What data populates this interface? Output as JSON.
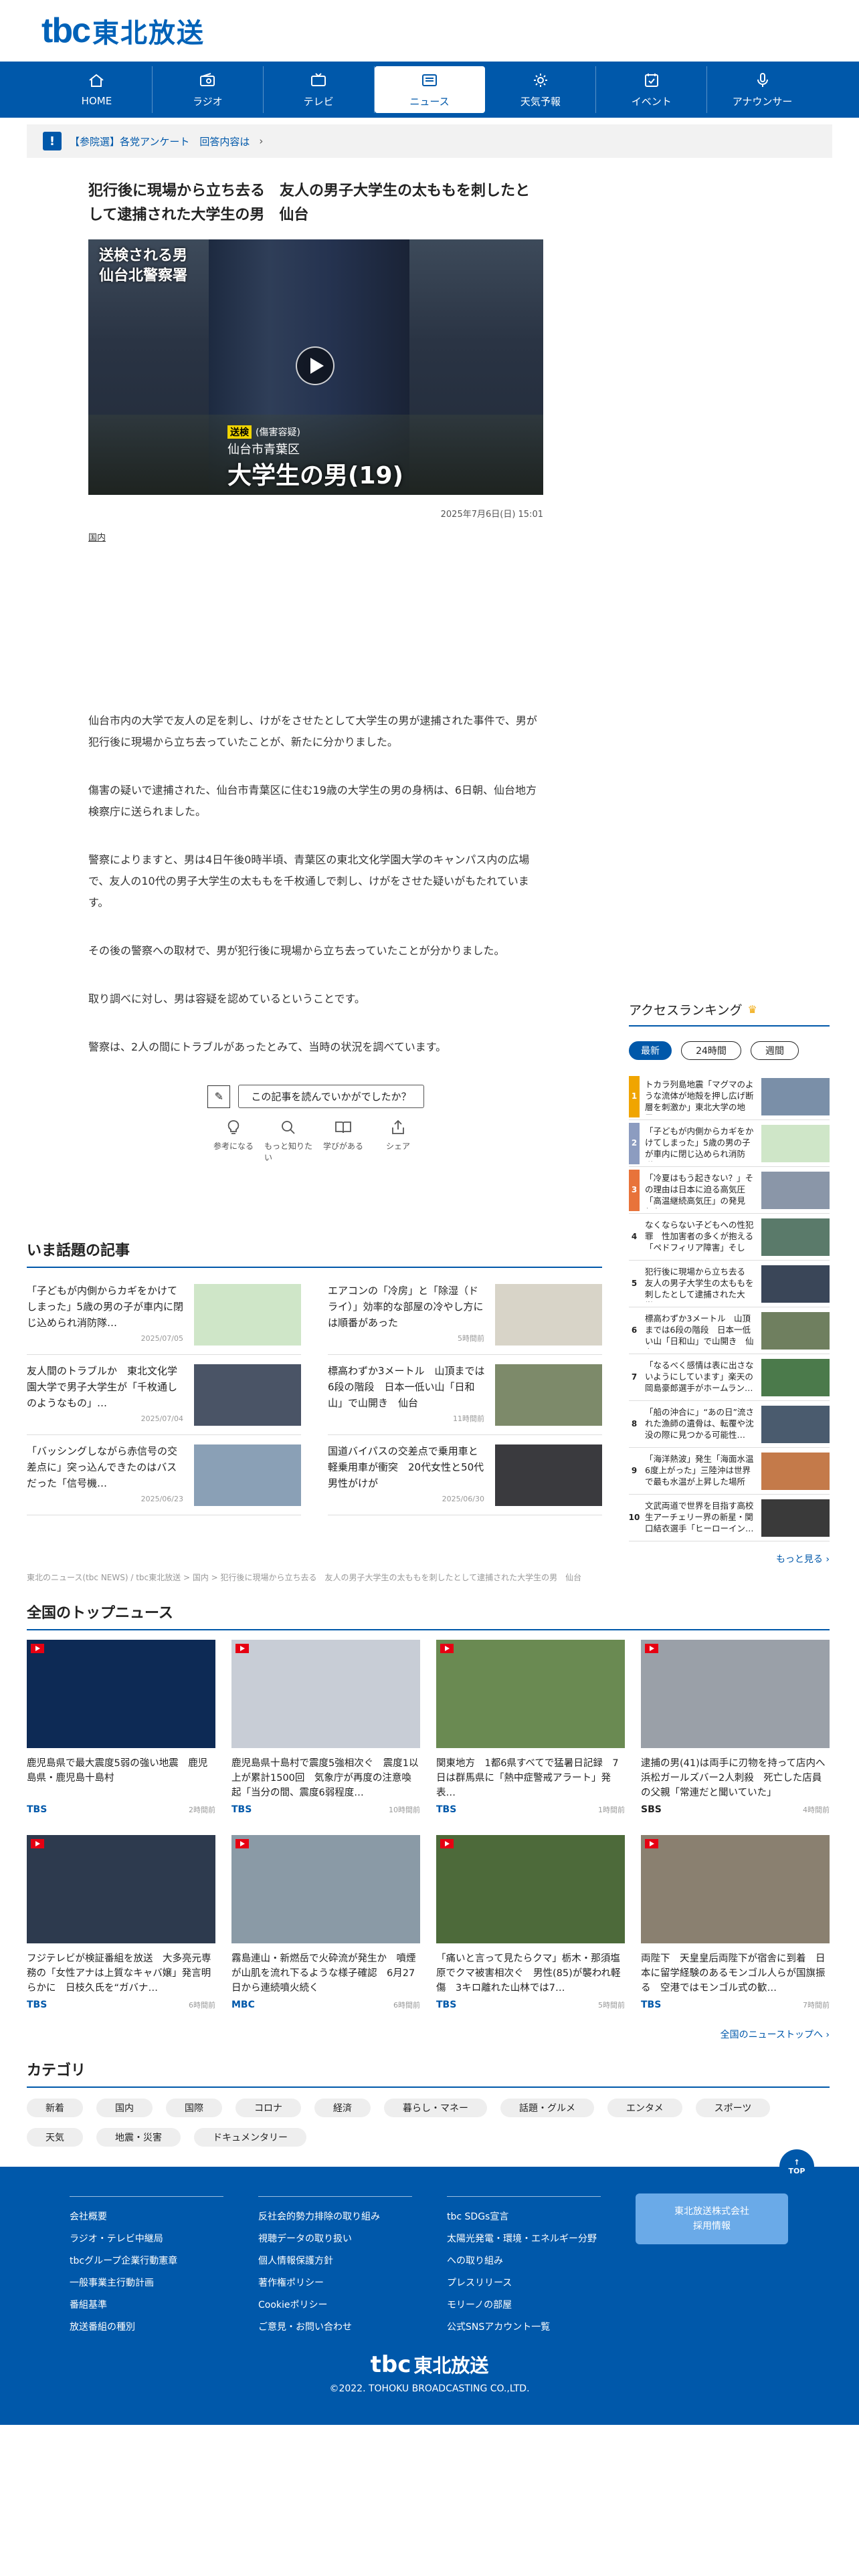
{
  "brand": {
    "mark": "tbc",
    "name": "東北放送",
    "color": "#0058aa"
  },
  "nav": [
    {
      "label": "HOME",
      "icon": "home-icon"
    },
    {
      "label": "ラジオ",
      "icon": "radio-icon"
    },
    {
      "label": "テレビ",
      "icon": "tv-icon"
    },
    {
      "label": "ニュース",
      "icon": "news-icon",
      "active": true
    },
    {
      "label": "天気予報",
      "icon": "weather-icon"
    },
    {
      "label": "イベント",
      "icon": "event-icon"
    },
    {
      "label": "アナウンサー",
      "icon": "mic-icon"
    }
  ],
  "notice": {
    "text": "【参院選】各党アンケート　回答内容は",
    "chevron": "›"
  },
  "article": {
    "title": "犯行後に現場から立ち去る　友人の男子大学生の太ももを刺したとして逮捕された大学生の男　仙台",
    "hero": {
      "caption1": "送検される男",
      "caption2": "仙台北警察署",
      "badge": "送検",
      "badge_note": "(傷害容疑)",
      "location": "仙台市青葉区",
      "name": "大学生の男(19)"
    },
    "date": "2025年7月6日(日) 15:01",
    "category": "国内",
    "paragraphs": [
      "仙台市内の大学で友人の足を刺し、けがをさせたとして大学生の男が逮捕された事件で、男が犯行後に現場から立ち去っていたことが、新たに分かりました。",
      "傷害の疑いで逮捕された、仙台市青葉区に住む19歳の大学生の男の身柄は、6日朝、仙台地方検察庁に送られました。",
      "警察によりますと、男は4日午後0時半頃、青葉区の東北文化学園大学のキャンパス内の広場で、友人の10代の男子大学生の太ももを千枚通しで刺し、けがをさせた疑いがもたれています。",
      "その後の警察への取材で、男が犯行後に現場から立ち去っていたことが分かりました。",
      "取り調べに対し、男は容疑を認めているということです。",
      "警察は、2人の間にトラブルがあったとみて、当時の状況を調べています。"
    ],
    "survey_label": "この記事を読んでいかがでしたか？",
    "reactions": [
      {
        "label": "参考になる",
        "icon": "lightbulb-icon"
      },
      {
        "label": "もっと知りたい",
        "icon": "magnifier-icon"
      },
      {
        "label": "学びがある",
        "icon": "book-icon"
      },
      {
        "label": "シェア",
        "icon": "share-icon"
      }
    ]
  },
  "ranking": {
    "title": "アクセスランキング",
    "tabs": [
      "最新",
      "24時間",
      "週間"
    ],
    "items": [
      {
        "no": "1",
        "text": "トカラ列島地震「マグマのような流体が地殻を押し広げ断層を刺激か」東北大学の地震…",
        "color": "#f0a500",
        "thumb": "#7a8fa8"
      },
      {
        "no": "2",
        "text": "「子どもが内側からカギをかけてしまった」5歳の男の子が車内に閉じ込められ消防隊…",
        "color": "#8c9cc0",
        "thumb": "#cfe6c8"
      },
      {
        "no": "3",
        "text": "「冷夏はもう起きない？」その理由は日本に迫る高気圧「高温継続高気圧」の発見　気象…",
        "color": "#e8733a",
        "thumb": "#8a96a8"
      },
      {
        "no": "4",
        "text": "なくならない子どもへの性犯罪　性加害者の多くが抱える「ペドフィリア障害」そして…",
        "color": "#ffffff",
        "thumb": "#5a7a6a"
      },
      {
        "no": "5",
        "text": "犯行後に現場から立ち去る　友人の男子大学生の太ももを刺したとして逮捕された大学…",
        "color": "#ffffff",
        "thumb": "#3a4658"
      },
      {
        "no": "6",
        "text": "標高わずか3メートル　山頂までは6段の階段　日本一低い山「日和山」で山開き　仙台",
        "color": "#ffffff",
        "thumb": "#6f7f5f"
      },
      {
        "no": "7",
        "text": "「なるべく感情は表に出さないようにしています」楽天の岡島豪郎選手がホームラン…",
        "color": "#ffffff",
        "thumb": "#4b7a4b"
      },
      {
        "no": "8",
        "text": "「船の沖合に」“あの日”流された漁師の遺骨は、転覆や沈没の際に見つかる可能性…",
        "color": "#ffffff",
        "thumb": "#4a5b6e"
      },
      {
        "no": "9",
        "text": "「海洋熱波」発生「海面水温6度上がった」三陸沖は世界で最も水温が上昇した場所に…",
        "color": "#ffffff",
        "thumb": "#c47a4a"
      },
      {
        "no": "10",
        "text": "文武両道で世界を目指す高校生アーチェリー界の新星・関口結衣選手「ヒーローイン…",
        "color": "#ffffff",
        "thumb": "#3a3a3a"
      }
    ],
    "more": "もっと見る ›"
  },
  "popular": {
    "title": "いま話題の記事",
    "items": [
      {
        "text": "「子どもが内側からカギをかけてしまった」5歳の男の子が車内に閉じ込められ消防隊…",
        "date": "2025/07/05",
        "thumb": "#cfe6c8"
      },
      {
        "text": "エアコンの「冷房」と「除湿（ドライ）」効率的な部屋の冷やし方には順番があった",
        "date": "5時間前",
        "thumb": "#d8d4c8"
      },
      {
        "text": "友人間のトラブルか　東北文化学園大学で男子大学生が「千枚通しのようなもの」…",
        "date": "2025/07/04",
        "thumb": "#4a5466"
      },
      {
        "text": "標高わずか3メートル　山頂までは6段の階段　日本一低い山「日和山」で山開き　仙台",
        "date": "11時間前",
        "thumb": "#7d8a6a"
      },
      {
        "text": "「バッシングしながら赤信号の交差点に」突っ込んできたのはバスだった「信号機…",
        "date": "2025/06/23",
        "thumb": "#8aa0b6"
      },
      {
        "text": "国道バイパスの交差点で乗用車と軽乗用車が衝突　20代女性と50代男性がけが",
        "date": "2025/06/30",
        "thumb": "#3a3a3e"
      }
    ]
  },
  "breadcrumb": "東北のニュース(tbc NEWS) / tbc東北放送 > 国内 > 犯行後に現場から立ち去る　友人の男子大学生の太ももを刺したとして逮捕された大学生の男　仙台",
  "national": {
    "title": "全国のトップニュース",
    "items": [
      {
        "title": "鹿児島県で最大震度5弱の強い地震　鹿児島県・鹿児島十島村",
        "source": "TBS",
        "time": "2時間前",
        "thumb": "#0d2a55"
      },
      {
        "title": "鹿児島県十島村で震度5強相次ぐ　震度1以上が累計1500回　気象庁が再度の注意喚起「当分の間、震度6弱程度…",
        "source": "TBS",
        "time": "10時間前",
        "thumb": "#c8cdd6"
      },
      {
        "title": "関東地方　1都6県すべてで猛暑日記録　7日は群馬県に「熱中症警戒アラート」発表…",
        "source": "TBS",
        "time": "1時間前",
        "thumb": "#6a8a52"
      },
      {
        "title": "逮捕の男(41)は両手に刃物を持って店内へ　浜松ガールズバー2人刺殺　死亡した店員の父親「常連だと聞いていた」",
        "source": "SBS",
        "time": "4時間前",
        "thumb": "#9aa0a8"
      },
      {
        "title": "フジテレビが検証番組を放送　大多亮元専務の「女性アナは上質なキャバ嬢」発言明らかに　日枝久氏を“ガバナ…",
        "source": "TBS",
        "time": "6時間前",
        "thumb": "#2d3a4e"
      },
      {
        "title": "霧島連山・新燃岳で火砕流が発生か　噴煙が山肌を流れ下るような様子確認　6月27日から連続噴火続く",
        "source": "MBC",
        "time": "6時間前",
        "thumb": "#8a9aa6"
      },
      {
        "title": "「痛いと言って見たらクマ」栃木・那須塩原でクマ被害相次ぐ　男性(85)が襲われ軽傷　3キロ離れた山林では7…",
        "source": "TBS",
        "time": "5時間前",
        "thumb": "#4d6a3a"
      },
      {
        "title": "両陛下　天皇皇后両陛下が宿舎に到着　日本に留学経験のあるモンゴル人らが国旗振る　空港ではモンゴル式の歓…",
        "source": "TBS",
        "time": "7時間前",
        "thumb": "#8a8070"
      }
    ],
    "more": "全国のニューストップへ ›"
  },
  "categories": {
    "title": "カテゴリ",
    "tags": [
      "新着",
      "国内",
      "国際",
      "コロナ",
      "経済",
      "暮らし・マネー",
      "話題・グルメ",
      "エンタメ",
      "スポーツ",
      "天気",
      "地震・災害",
      "ドキュメンタリー"
    ]
  },
  "footer": {
    "top_label": "TOP",
    "cols": [
      [
        "会社概要",
        "ラジオ・テレビ中継局",
        "tbcグループ企業行動憲章",
        "一般事業主行動計画",
        "番組基準",
        "放送番組の種別"
      ],
      [
        "反社会的勢力排除の取り組み",
        "視聴データの取り扱い",
        "個人情報保護方針",
        "著作権ポリシー",
        "Cookieポリシー",
        "ご意見・お問い合わせ"
      ],
      [
        "tbc SDGs宣言",
        "太陽光発電・環境・エネルギー分野への取り組み",
        "プレスリリース",
        "モリーノの部屋",
        "公式SNSアカウント一覧"
      ]
    ],
    "recruit": "東北放送株式会社\n採用情報",
    "copyright": "©2022. TOHOKU BROADCASTING CO.,LTD."
  }
}
